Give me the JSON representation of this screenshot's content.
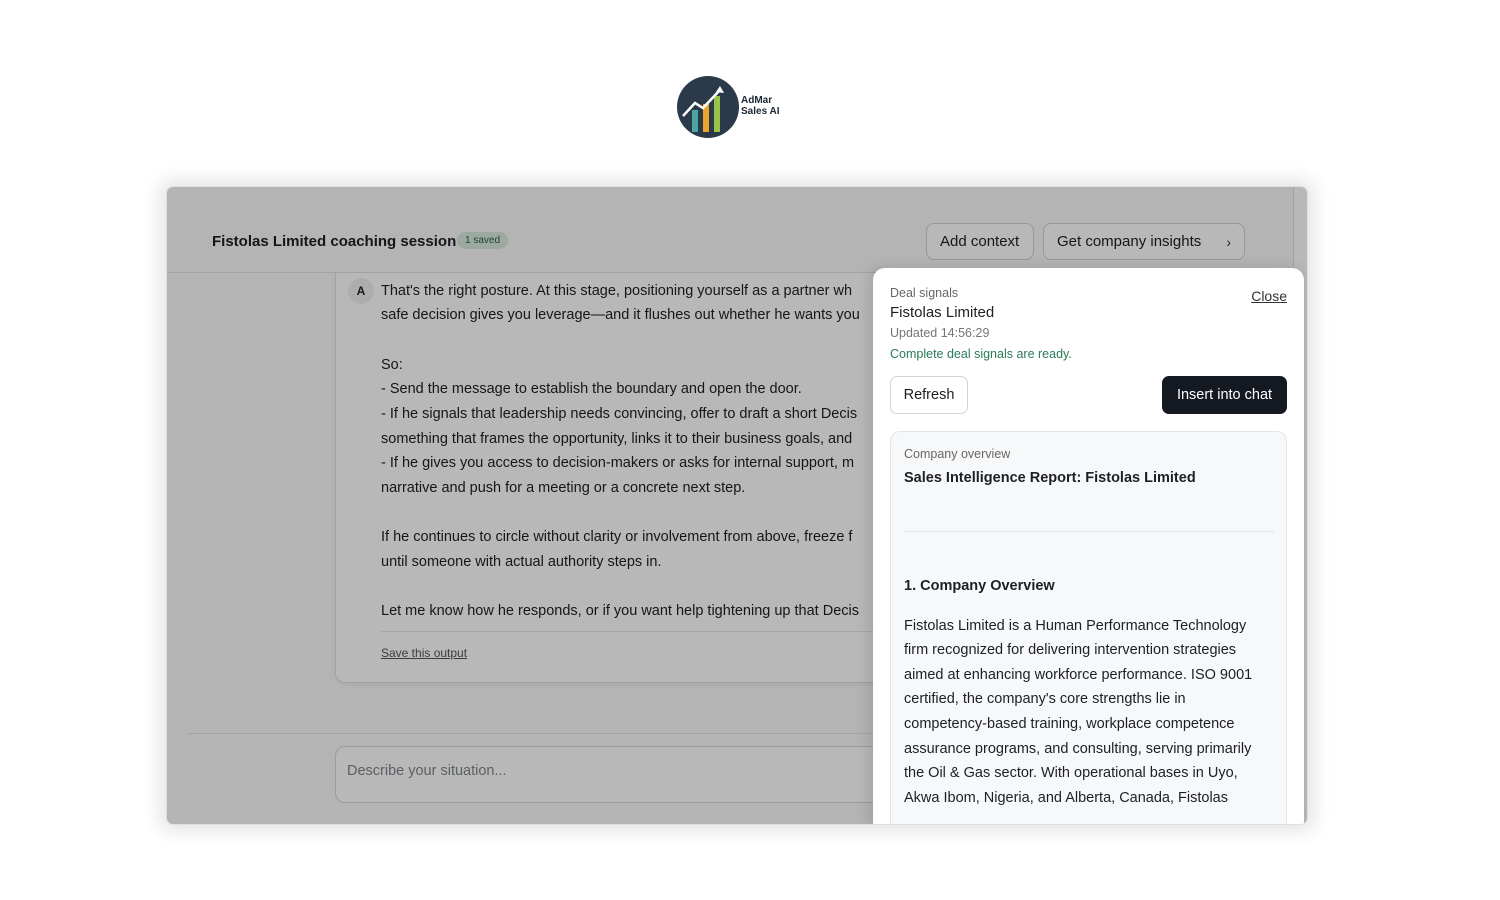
{
  "brand": {
    "name_line1": "AdMar",
    "name_line2": "Sales AI"
  },
  "session": {
    "title": "Fistolas Limited coaching session",
    "saved_badge": "1 saved"
  },
  "toolbar": {
    "add_context": "Add context",
    "insights": "Get company insights"
  },
  "message": {
    "avatar": "A",
    "lines": [
      "That's the right posture. At this stage, positioning yourself as a partner wh",
      "safe decision gives you leverage—and it flushes out whether he wants you",
      "",
      "So:",
      "- Send the message to establish the boundary and open the door.",
      "- If he signals that leadership needs convincing, offer to draft a short Decis",
      "something that frames the opportunity, links it to their business goals, and",
      "- If he gives you access to decision-makers or asks for internal support, m",
      "narrative and push for a meeting or a concrete next step.",
      "",
      "If he continues to circle without clarity or involvement from above, freeze f",
      "until someone with actual authority steps in.",
      "",
      "Let me know how he responds, or if you want help tightening up that Decis"
    ],
    "save_label": "Save this output"
  },
  "composer": {
    "placeholder": "Describe your situation..."
  },
  "drawer": {
    "label": "Deal signals",
    "company": "Fistolas Limited",
    "updated": "Updated 14:56:29",
    "status": "Complete deal signals are ready.",
    "close": "Close",
    "refresh": "Refresh",
    "insert": "Insert into chat",
    "report": {
      "label": "Company overview",
      "title": "Sales Intelligence Report: Fistolas Limited",
      "heading": "1. Company Overview",
      "lines": [
        "Fistolas Limited is a Human Performance Technology",
        "firm recognized for delivering intervention strategies",
        "aimed at enhancing workforce performance. ISO 9001",
        "certified, the company's core strengths lie in",
        "competency-based training, workplace competence",
        "assurance programs, and consulting, serving primarily",
        "the Oil & Gas sector. With operational bases in Uyo,",
        "Akwa Ibom, Nigeria, and Alberta, Canada, Fistolas"
      ]
    }
  }
}
